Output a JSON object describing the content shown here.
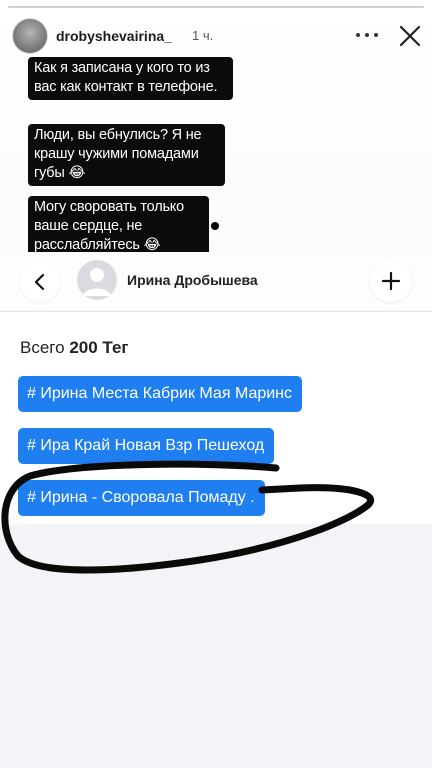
{
  "story": {
    "username": "drobyshevairina_",
    "time": "1 ч.",
    "captions": [
      "Как я записана у кого то из вас как контакт в телефоне.",
      "Люди, вы ебнулись? Я не крашу чужими помадами губы 😂",
      "Могу своровать только ваше сердце, не расслабляйтесь 😂"
    ]
  },
  "profile": {
    "name": "Ирина Дробышева"
  },
  "tags": {
    "total_prefix": "Всего",
    "total_count": "200",
    "total_suffix": "Тег",
    "items": [
      "# Ирина Места Кабрик Мая Маринс",
      "# Ира Край Новая Взр Пешеход",
      "# Ирина - Своровала Помаду ."
    ]
  },
  "icons": {
    "back": "chevron-left-icon",
    "add": "plus-icon",
    "close": "close-icon",
    "more": "more-dots-icon",
    "person": "person-placeholder-icon"
  },
  "colors": {
    "tag_bg": "#1f7ff0",
    "caption_bg": "#0b0b0b"
  }
}
